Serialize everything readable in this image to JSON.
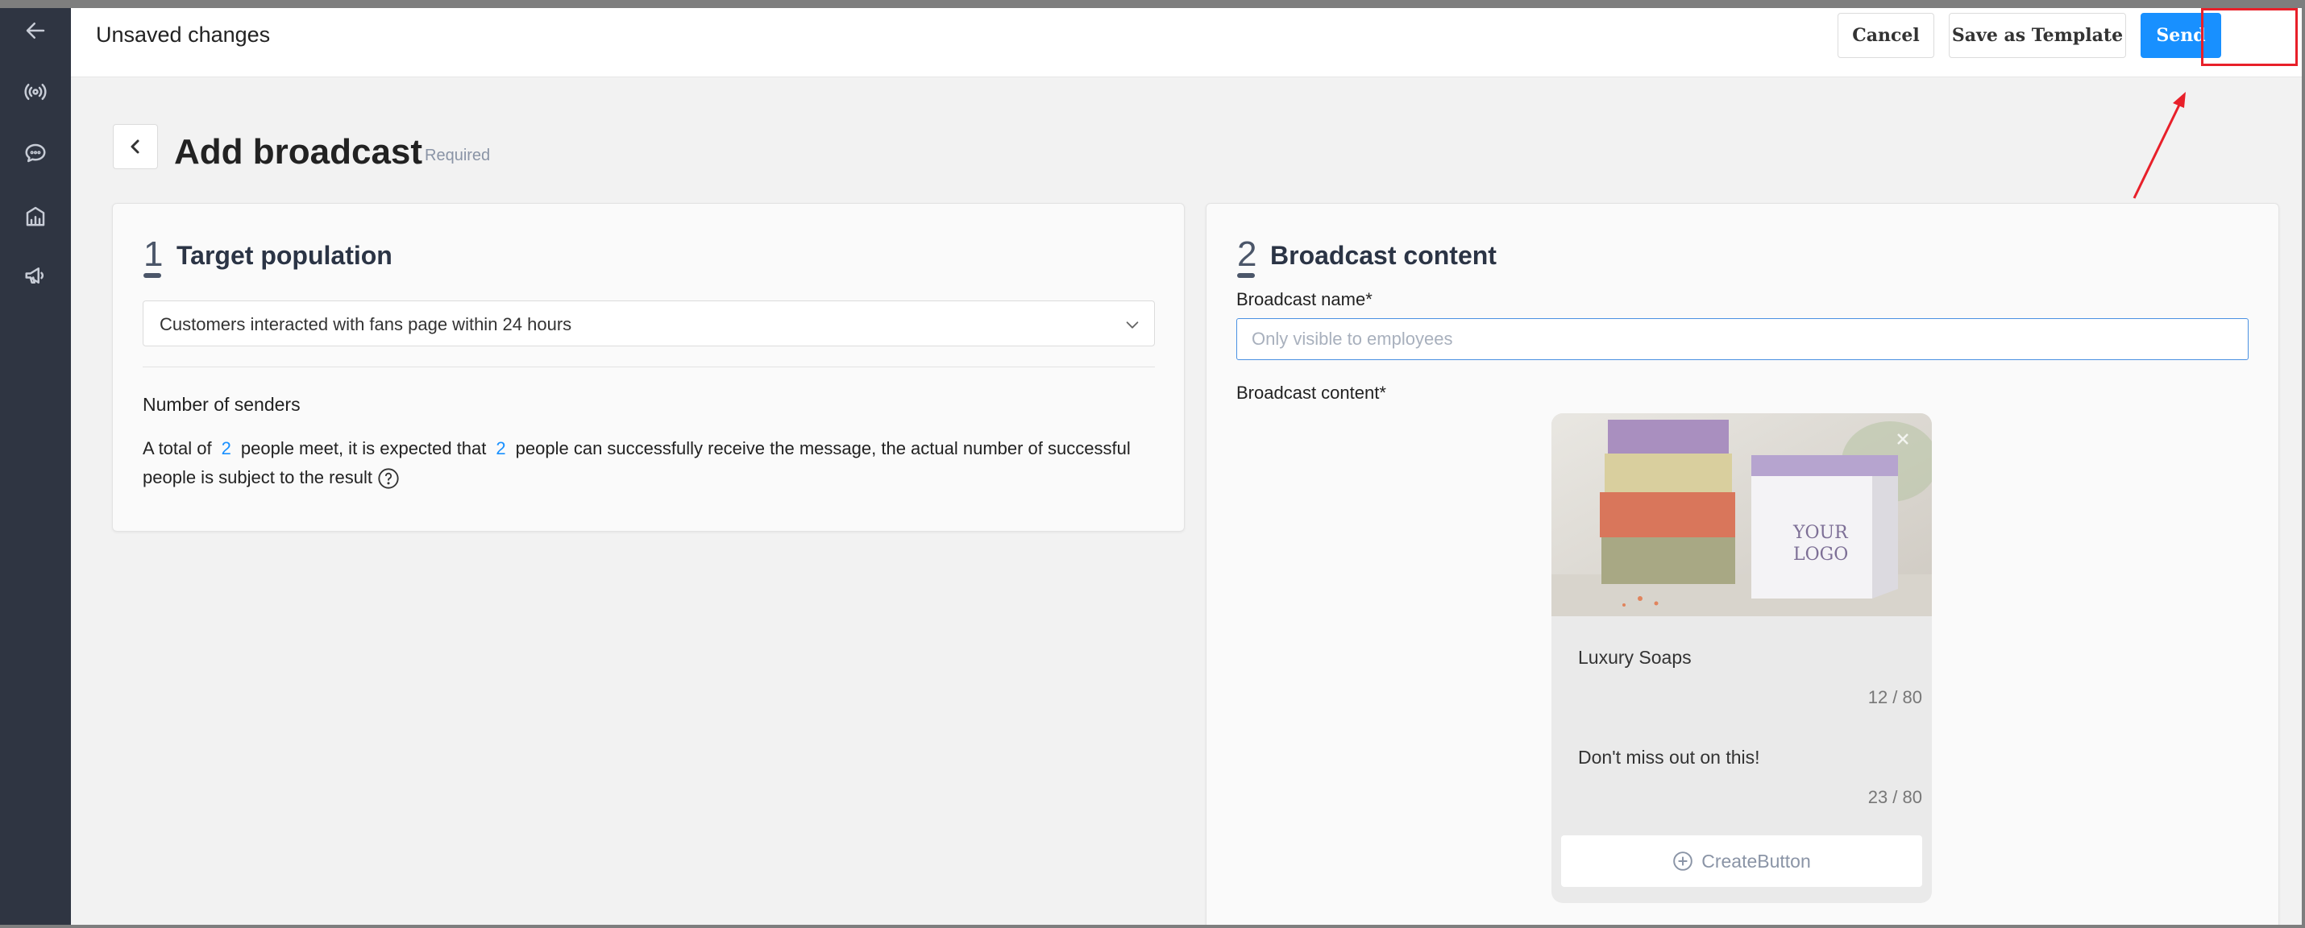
{
  "topbar": {
    "title": "Unsaved changes",
    "cancel_label": "Cancel",
    "template_label": "Save as Template",
    "send_label": "Send"
  },
  "sidebar": {
    "items": [
      {
        "icon": "arrow-left-icon"
      },
      {
        "icon": "broadcast-icon"
      },
      {
        "icon": "chat-icon"
      },
      {
        "icon": "building-chart-icon"
      },
      {
        "icon": "megaphone-icon"
      }
    ]
  },
  "page": {
    "title": "Add broadcast",
    "required": "Required"
  },
  "target": {
    "step": "1",
    "title": "Target population",
    "selected": "Customers interacted with fans page within 24 hours",
    "senders_label": "Number of senders",
    "text_1": "A total of",
    "count_a": "2",
    "text_2": "people meet, it is expected that",
    "count_b": "2",
    "text_3": "people can successfully receive the message, the actual number of successful people is subject to the result"
  },
  "content": {
    "step": "2",
    "title": "Broadcast content",
    "name_label": "Broadcast name*",
    "name_placeholder": "Only visible to employees",
    "name_value": "",
    "content_label": "Broadcast content*",
    "card": {
      "image_text_line1": "YOUR",
      "image_text_line2": "LOGO",
      "title": "Luxury Soaps",
      "title_count": "12 / 80",
      "subtitle": "Don't miss out on this!",
      "subtitle_count": "23 / 80",
      "create_button": "CreateButton"
    }
  },
  "colors": {
    "accent": "#1890ff",
    "sidebar": "#2f3542",
    "highlight": "#e8202a"
  }
}
